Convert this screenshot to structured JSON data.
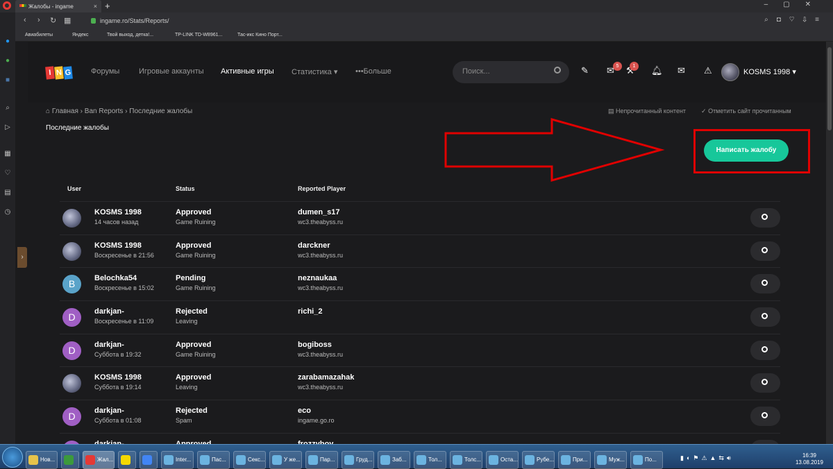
{
  "browser": {
    "tab_title": "Жалобы - ingame",
    "url": "ingame.ro/Stats/Reports/",
    "bookmarks": [
      "Авиабилеты",
      "Яндекс",
      "Твой выход, детка!...",
      "TP-LINK TD-W8961...",
      "Тас-икс Кино Порт..."
    ]
  },
  "site": {
    "logo_letters": [
      "I",
      "N",
      "G"
    ],
    "logo_colors": [
      "#e53935",
      "#fbc02d",
      "#1e88e5"
    ],
    "nav": [
      "Форумы",
      "Игровые аккаунты",
      "Активные игры",
      "Статистика ▾",
      "•••Больше"
    ],
    "search_placeholder": "Поиск...",
    "badges": {
      "inbox": "5",
      "mod": "1"
    },
    "username": "KOSMS 1998 ▾"
  },
  "breadcrumb": {
    "home": "Главная",
    "sep1": "›",
    "item2": "Ban Reports",
    "sep2": "›",
    "item3": "Последние жалобы"
  },
  "links": {
    "unread": "Непрочитанный контент",
    "mark_read": "Отметить сайт прочитанным"
  },
  "page_title": "Последние жалобы",
  "cta": "Написать жалобу",
  "accent": "#17c79a",
  "table": {
    "headers": {
      "user": "User",
      "status": "Status",
      "player": "Reported Player"
    },
    "rows": [
      {
        "avatar": "img",
        "letter": "",
        "avatar_color": "",
        "user": "KOSMS 1998",
        "time": "14 часов назад",
        "status": "Approved",
        "reason": "Game Ruining",
        "player": "dumen_s17",
        "server": "wc3.theabyss.ru"
      },
      {
        "avatar": "img",
        "letter": "",
        "avatar_color": "",
        "user": "KOSMS 1998",
        "time": "Воскресенье в 21:56",
        "status": "Approved",
        "reason": "Game Ruining",
        "player": "darckner",
        "server": "wc3.theabyss.ru"
      },
      {
        "avatar": "letter",
        "letter": "B",
        "avatar_color": "#5aa3c9",
        "user": "Belochka54",
        "time": "Воскресенье в 15:02",
        "status": "Pending",
        "reason": "Game Ruining",
        "player": "neznaukaa",
        "server": "wc3.theabyss.ru"
      },
      {
        "avatar": "letter",
        "letter": "D",
        "avatar_color": "#a05fc4",
        "user": "darkjan-",
        "time": "Воскресенье в 11:09",
        "status": "Rejected",
        "reason": "Leaving",
        "player": "richi_2",
        "server": ""
      },
      {
        "avatar": "letter",
        "letter": "D",
        "avatar_color": "#a05fc4",
        "user": "darkjan-",
        "time": "Суббота в 19:32",
        "status": "Approved",
        "reason": "Game Ruining",
        "player": "bogiboss",
        "server": "wc3.theabyss.ru"
      },
      {
        "avatar": "img",
        "letter": "",
        "avatar_color": "",
        "user": "KOSMS 1998",
        "time": "Суббота в 19:14",
        "status": "Approved",
        "reason": "Leaving",
        "player": "zarabamazahak",
        "server": "wc3.theabyss.ru"
      },
      {
        "avatar": "letter",
        "letter": "D",
        "avatar_color": "#a05fc4",
        "user": "darkjan-",
        "time": "Суббота в 01:08",
        "status": "Rejected",
        "reason": "Spam",
        "player": "eco",
        "server": "ingame.go.ro"
      },
      {
        "avatar": "letter",
        "letter": "D",
        "avatar_color": "#a05fc4",
        "user": "darkjan-",
        "time": "",
        "status": "Approved",
        "reason": "",
        "player": "frozzyboy",
        "server": ""
      }
    ]
  },
  "taskbar": {
    "items": [
      "Нов...",
      "",
      "Жал...",
      "",
      "",
      "Inter...",
      "Пас...",
      "Секс...",
      "У же...",
      "Пар...",
      "Груд...",
      "Заб...",
      "Тол...",
      "Толс...",
      "Оста...",
      "Рубе...",
      "При...",
      "Муж...",
      "По..."
    ],
    "clock_time": "16:39",
    "clock_date": "13.08.2019"
  }
}
